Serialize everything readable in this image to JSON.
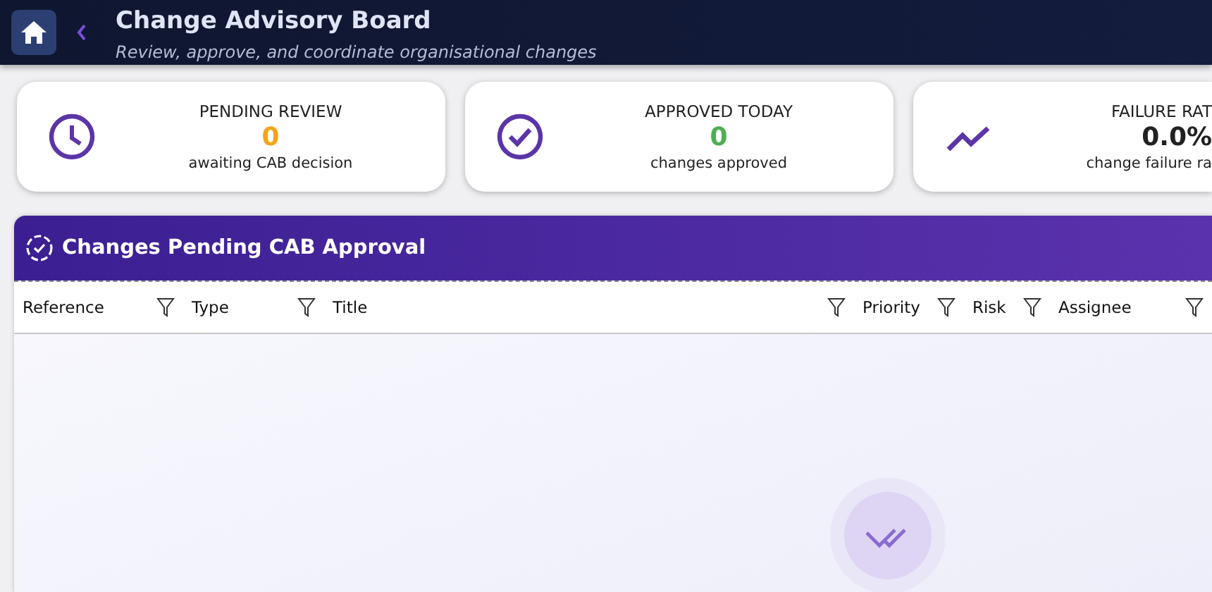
{
  "header": {
    "title": "Change Advisory Board",
    "subtitle": "Review, approve, and coordinate organisational changes"
  },
  "stats": [
    {
      "kind": "clock",
      "label": "PENDING REVIEW",
      "value": "0",
      "color": "#f5a31a",
      "note": "awaiting CAB decision"
    },
    {
      "kind": "check",
      "label": "APPROVED TODAY",
      "value": "0",
      "color": "#4caf50",
      "note": "changes approved"
    },
    {
      "kind": "trend",
      "label": "FAILURE RAT",
      "value": "0.0%",
      "color": "#222222",
      "note": "change failure ra"
    }
  ],
  "panel": {
    "title": "Changes Pending CAB Approval",
    "columns": [
      "Reference",
      "Type",
      "Title",
      "Priority",
      "Risk",
      "Assignee"
    ]
  }
}
